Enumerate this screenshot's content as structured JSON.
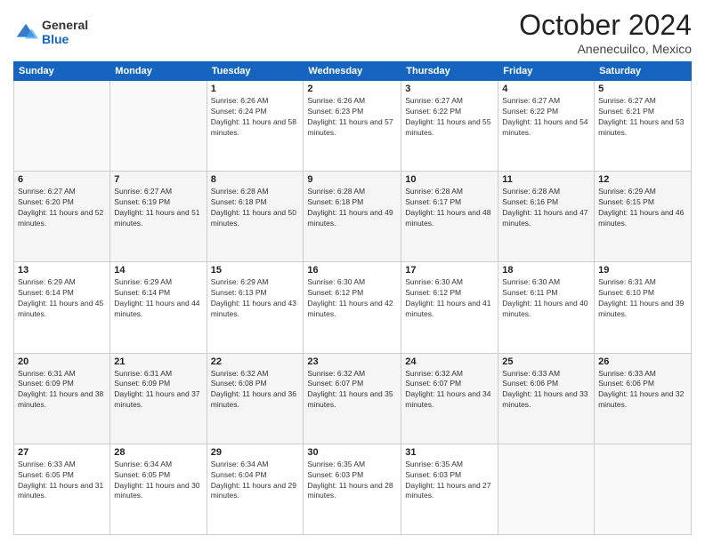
{
  "logo": {
    "general": "General",
    "blue": "Blue"
  },
  "header": {
    "month": "October 2024",
    "location": "Anenecuilco, Mexico"
  },
  "days_of_week": [
    "Sunday",
    "Monday",
    "Tuesday",
    "Wednesday",
    "Thursday",
    "Friday",
    "Saturday"
  ],
  "weeks": [
    [
      {
        "day": "",
        "sunrise": "",
        "sunset": "",
        "daylight": ""
      },
      {
        "day": "",
        "sunrise": "",
        "sunset": "",
        "daylight": ""
      },
      {
        "day": "1",
        "sunrise": "Sunrise: 6:26 AM",
        "sunset": "Sunset: 6:24 PM",
        "daylight": "Daylight: 11 hours and 58 minutes."
      },
      {
        "day": "2",
        "sunrise": "Sunrise: 6:26 AM",
        "sunset": "Sunset: 6:23 PM",
        "daylight": "Daylight: 11 hours and 57 minutes."
      },
      {
        "day": "3",
        "sunrise": "Sunrise: 6:27 AM",
        "sunset": "Sunset: 6:22 PM",
        "daylight": "Daylight: 11 hours and 55 minutes."
      },
      {
        "day": "4",
        "sunrise": "Sunrise: 6:27 AM",
        "sunset": "Sunset: 6:22 PM",
        "daylight": "Daylight: 11 hours and 54 minutes."
      },
      {
        "day": "5",
        "sunrise": "Sunrise: 6:27 AM",
        "sunset": "Sunset: 6:21 PM",
        "daylight": "Daylight: 11 hours and 53 minutes."
      }
    ],
    [
      {
        "day": "6",
        "sunrise": "Sunrise: 6:27 AM",
        "sunset": "Sunset: 6:20 PM",
        "daylight": "Daylight: 11 hours and 52 minutes."
      },
      {
        "day": "7",
        "sunrise": "Sunrise: 6:27 AM",
        "sunset": "Sunset: 6:19 PM",
        "daylight": "Daylight: 11 hours and 51 minutes."
      },
      {
        "day": "8",
        "sunrise": "Sunrise: 6:28 AM",
        "sunset": "Sunset: 6:18 PM",
        "daylight": "Daylight: 11 hours and 50 minutes."
      },
      {
        "day": "9",
        "sunrise": "Sunrise: 6:28 AM",
        "sunset": "Sunset: 6:18 PM",
        "daylight": "Daylight: 11 hours and 49 minutes."
      },
      {
        "day": "10",
        "sunrise": "Sunrise: 6:28 AM",
        "sunset": "Sunset: 6:17 PM",
        "daylight": "Daylight: 11 hours and 48 minutes."
      },
      {
        "day": "11",
        "sunrise": "Sunrise: 6:28 AM",
        "sunset": "Sunset: 6:16 PM",
        "daylight": "Daylight: 11 hours and 47 minutes."
      },
      {
        "day": "12",
        "sunrise": "Sunrise: 6:29 AM",
        "sunset": "Sunset: 6:15 PM",
        "daylight": "Daylight: 11 hours and 46 minutes."
      }
    ],
    [
      {
        "day": "13",
        "sunrise": "Sunrise: 6:29 AM",
        "sunset": "Sunset: 6:14 PM",
        "daylight": "Daylight: 11 hours and 45 minutes."
      },
      {
        "day": "14",
        "sunrise": "Sunrise: 6:29 AM",
        "sunset": "Sunset: 6:14 PM",
        "daylight": "Daylight: 11 hours and 44 minutes."
      },
      {
        "day": "15",
        "sunrise": "Sunrise: 6:29 AM",
        "sunset": "Sunset: 6:13 PM",
        "daylight": "Daylight: 11 hours and 43 minutes."
      },
      {
        "day": "16",
        "sunrise": "Sunrise: 6:30 AM",
        "sunset": "Sunset: 6:12 PM",
        "daylight": "Daylight: 11 hours and 42 minutes."
      },
      {
        "day": "17",
        "sunrise": "Sunrise: 6:30 AM",
        "sunset": "Sunset: 6:12 PM",
        "daylight": "Daylight: 11 hours and 41 minutes."
      },
      {
        "day": "18",
        "sunrise": "Sunrise: 6:30 AM",
        "sunset": "Sunset: 6:11 PM",
        "daylight": "Daylight: 11 hours and 40 minutes."
      },
      {
        "day": "19",
        "sunrise": "Sunrise: 6:31 AM",
        "sunset": "Sunset: 6:10 PM",
        "daylight": "Daylight: 11 hours and 39 minutes."
      }
    ],
    [
      {
        "day": "20",
        "sunrise": "Sunrise: 6:31 AM",
        "sunset": "Sunset: 6:09 PM",
        "daylight": "Daylight: 11 hours and 38 minutes."
      },
      {
        "day": "21",
        "sunrise": "Sunrise: 6:31 AM",
        "sunset": "Sunset: 6:09 PM",
        "daylight": "Daylight: 11 hours and 37 minutes."
      },
      {
        "day": "22",
        "sunrise": "Sunrise: 6:32 AM",
        "sunset": "Sunset: 6:08 PM",
        "daylight": "Daylight: 11 hours and 36 minutes."
      },
      {
        "day": "23",
        "sunrise": "Sunrise: 6:32 AM",
        "sunset": "Sunset: 6:07 PM",
        "daylight": "Daylight: 11 hours and 35 minutes."
      },
      {
        "day": "24",
        "sunrise": "Sunrise: 6:32 AM",
        "sunset": "Sunset: 6:07 PM",
        "daylight": "Daylight: 11 hours and 34 minutes."
      },
      {
        "day": "25",
        "sunrise": "Sunrise: 6:33 AM",
        "sunset": "Sunset: 6:06 PM",
        "daylight": "Daylight: 11 hours and 33 minutes."
      },
      {
        "day": "26",
        "sunrise": "Sunrise: 6:33 AM",
        "sunset": "Sunset: 6:06 PM",
        "daylight": "Daylight: 11 hours and 32 minutes."
      }
    ],
    [
      {
        "day": "27",
        "sunrise": "Sunrise: 6:33 AM",
        "sunset": "Sunset: 6:05 PM",
        "daylight": "Daylight: 11 hours and 31 minutes."
      },
      {
        "day": "28",
        "sunrise": "Sunrise: 6:34 AM",
        "sunset": "Sunset: 6:05 PM",
        "daylight": "Daylight: 11 hours and 30 minutes."
      },
      {
        "day": "29",
        "sunrise": "Sunrise: 6:34 AM",
        "sunset": "Sunset: 6:04 PM",
        "daylight": "Daylight: 11 hours and 29 minutes."
      },
      {
        "day": "30",
        "sunrise": "Sunrise: 6:35 AM",
        "sunset": "Sunset: 6:03 PM",
        "daylight": "Daylight: 11 hours and 28 minutes."
      },
      {
        "day": "31",
        "sunrise": "Sunrise: 6:35 AM",
        "sunset": "Sunset: 6:03 PM",
        "daylight": "Daylight: 11 hours and 27 minutes."
      },
      {
        "day": "",
        "sunrise": "",
        "sunset": "",
        "daylight": ""
      },
      {
        "day": "",
        "sunrise": "",
        "sunset": "",
        "daylight": ""
      }
    ]
  ]
}
